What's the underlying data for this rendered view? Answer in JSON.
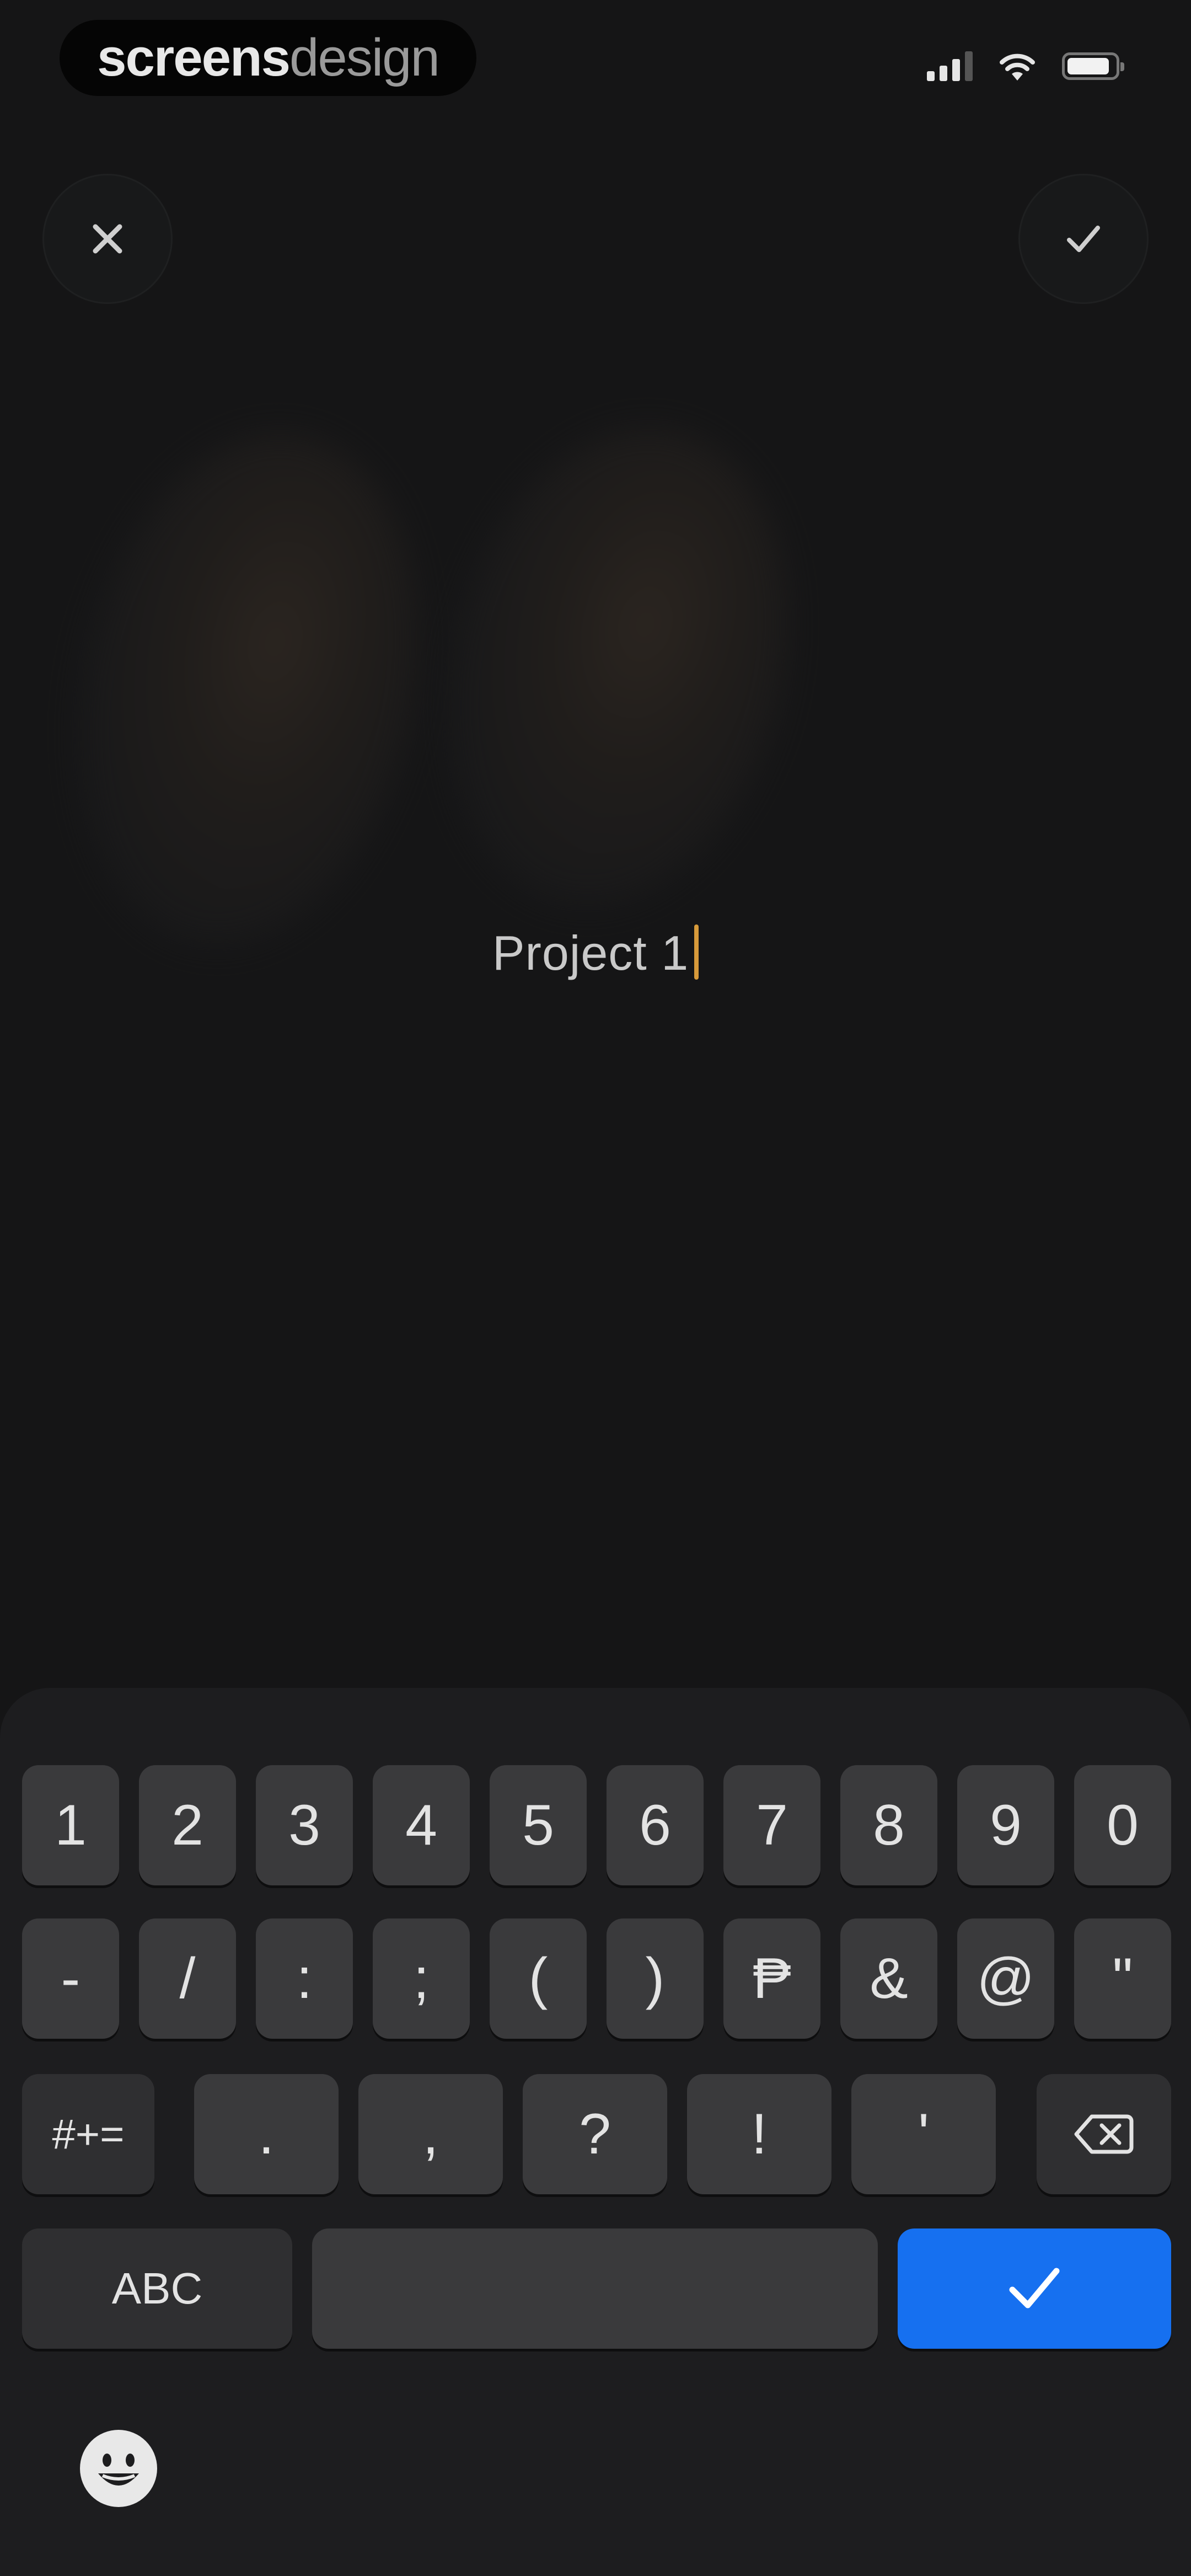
{
  "status_bar": {
    "brand_bold": "screens",
    "brand_light": "design",
    "signal_icon": "cellular-signal-icon",
    "wifi_icon": "wifi-icon",
    "battery_icon": "battery-icon"
  },
  "header": {
    "close_icon": "close-icon",
    "confirm_icon": "checkmark-icon"
  },
  "editor": {
    "project_name_value": "Project 1"
  },
  "keyboard": {
    "row1": [
      "1",
      "2",
      "3",
      "4",
      "5",
      "6",
      "7",
      "8",
      "9",
      "0"
    ],
    "row2": [
      "-",
      "/",
      ":",
      ";",
      "(",
      ")",
      "₱",
      "&",
      "@",
      "\""
    ],
    "row3": {
      "more_symbols": "#+=",
      "keys": [
        ".",
        ",",
        "?",
        "!",
        "'"
      ],
      "delete_icon": "backspace-icon"
    },
    "row4": {
      "abc_label": "ABC",
      "space_label": "",
      "return_icon": "checkmark-icon"
    },
    "emoji_icon": "emoji-icon"
  },
  "colors": {
    "background": "#151516",
    "keyboard_bg": "#1d1d1f",
    "key": "#3a3a3c",
    "return_key": "#1670f0",
    "caret": "#d79a3a"
  }
}
